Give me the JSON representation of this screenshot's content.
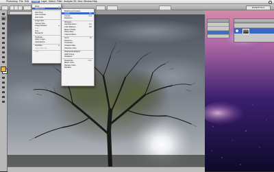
{
  "menubar": {
    "items": [
      {
        "label": "Photoshop"
      },
      {
        "label": "File"
      },
      {
        "label": "Edit"
      },
      {
        "label": "Image",
        "active": true
      },
      {
        "label": "Layer"
      },
      {
        "label": "Select"
      },
      {
        "label": "Filter"
      },
      {
        "label": "Analysis"
      },
      {
        "label": "3D"
      },
      {
        "label": "View"
      },
      {
        "label": "Window"
      },
      {
        "label": "Help"
      }
    ],
    "right": ""
  },
  "options_bar": {
    "workspace": "ESSENTIALS"
  },
  "document": {
    "tab_title": ""
  },
  "status": {
    "zoom": "",
    "info": ""
  },
  "image_menu": {
    "items": [
      {
        "label": "Mode",
        "submenu": true
      },
      {
        "label": "Adjustments",
        "submenu": true,
        "highlight": true
      },
      {
        "sep": true
      },
      {
        "label": "Auto Tone",
        "shortcut": ""
      },
      {
        "label": "Auto Contrast",
        "shortcut": ""
      },
      {
        "label": "Auto Color",
        "shortcut": ""
      },
      {
        "sep": true
      },
      {
        "label": "Image Size...",
        "shortcut": ""
      },
      {
        "label": "Canvas Size...",
        "shortcut": ""
      },
      {
        "label": "Image Rotation",
        "submenu": true
      },
      {
        "label": "Crop",
        "disabled": true
      },
      {
        "label": "Trim..."
      },
      {
        "label": "Reveal All"
      },
      {
        "sep": true
      },
      {
        "label": "Duplicate..."
      },
      {
        "label": "Apply Image..."
      },
      {
        "label": "Calculations..."
      },
      {
        "sep": true
      },
      {
        "label": "Variables",
        "submenu": true
      },
      {
        "label": "Apply Data Set...",
        "disabled": true
      },
      {
        "sep": true
      },
      {
        "label": "Trap...",
        "disabled": true
      }
    ]
  },
  "adjust_menu": {
    "items": [
      {
        "label": "Brightness/Contrast...",
        "shortcut": ""
      },
      {
        "label": "Levels...",
        "shortcut": "⌘L",
        "highlight": true
      },
      {
        "label": "Curves...",
        "shortcut": "⌘M"
      },
      {
        "label": "Exposure...",
        "shortcut": ""
      },
      {
        "sep": true
      },
      {
        "label": "Vibrance...",
        "shortcut": ""
      },
      {
        "label": "Hue/Saturation...",
        "shortcut": "⌘U"
      },
      {
        "label": "Color Balance...",
        "shortcut": "⌘B"
      },
      {
        "label": "Black & White...",
        "shortcut": ""
      },
      {
        "label": "Photo Filter...",
        "shortcut": ""
      },
      {
        "label": "Channel Mixer...",
        "shortcut": ""
      },
      {
        "sep": true
      },
      {
        "label": "Invert",
        "shortcut": "⌘I"
      },
      {
        "label": "Posterize...",
        "shortcut": ""
      },
      {
        "label": "Threshold...",
        "shortcut": ""
      },
      {
        "label": "Gradient Map...",
        "shortcut": ""
      },
      {
        "label": "Selective Color...",
        "shortcut": ""
      },
      {
        "sep": true
      },
      {
        "label": "Shadows/Highlights...",
        "shortcut": ""
      },
      {
        "label": "HDR Toning...",
        "shortcut": ""
      },
      {
        "label": "Variations...",
        "shortcut": ""
      },
      {
        "sep": true
      },
      {
        "label": "Desaturate",
        "shortcut": "⇧⌘U"
      },
      {
        "label": "Match Color...",
        "shortcut": ""
      },
      {
        "label": "Replace Color...",
        "shortcut": ""
      },
      {
        "label": "Equalize",
        "shortcut": ""
      }
    ]
  },
  "mini_panel": {
    "rows": [
      {
        "label": ""
      },
      {
        "label": ""
      },
      {
        "label": "",
        "selected": true
      }
    ]
  },
  "layers": {
    "title": "",
    "layer_name": ""
  },
  "colors": {
    "accent": "#3565c9",
    "menubar": "#e8e8e8",
    "panel": "#c6c6c6"
  }
}
